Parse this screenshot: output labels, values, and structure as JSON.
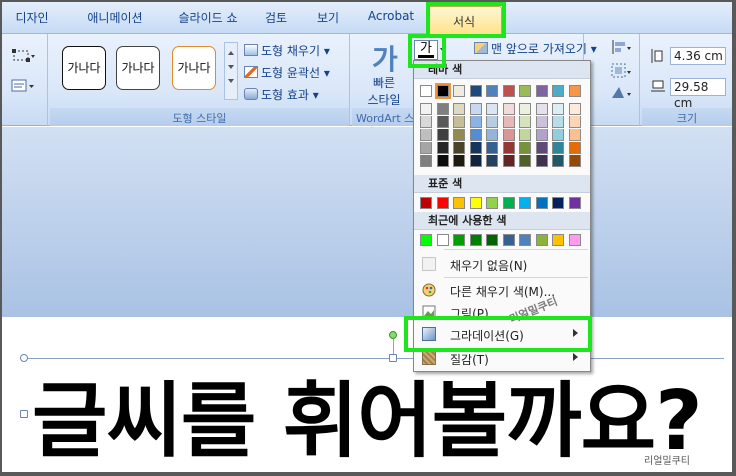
{
  "tabs": [
    "디자인",
    "애니메이션",
    "슬라이드 쇼",
    "검토",
    "보기",
    "Acrobat",
    "서식"
  ],
  "active_tab": "서식",
  "shape_style": {
    "preview_label": "가나다",
    "fill": "도형 채우기",
    "outline": "도형 윤곽선",
    "effects": "도형 효과",
    "group_label": "도형 스타일"
  },
  "wordart": {
    "quick_styles": "빠른\n스타일",
    "quick_line1": "빠른",
    "quick_line2": "스타일",
    "group_label": "WordArt 스",
    "font_color_glyph": "가"
  },
  "arrange": {
    "bring_front": "맨 앞으로 가져오기"
  },
  "size": {
    "height": "4.36 cm",
    "width": "29.58 cm",
    "group_label": "크기"
  },
  "dropdown": {
    "theme_colors_title": "테마 색",
    "standard_colors_title": "표준 색",
    "recent_colors_title": "최근에 사용한 색",
    "no_fill": "채우기 없음(N)",
    "more_fill_colors": "다른 채우기 색(M)...",
    "picture": "그림(P)...",
    "gradient": "그라데이션(G)",
    "texture": "질감(T)"
  },
  "theme_colors_top": [
    "#ffffff",
    "#000000",
    "#eeece1",
    "#1f497d",
    "#4f81bd",
    "#c0504d",
    "#9bbb59",
    "#8064a2",
    "#4bacc6",
    "#f79646"
  ],
  "theme_shades": [
    [
      "#f2f2f2",
      "#7f7f7f",
      "#ddd9c3",
      "#c6d9f0",
      "#dbe5f1",
      "#f2dcdb",
      "#ebf1dd",
      "#e5e0ec",
      "#dbeef3",
      "#fdeada"
    ],
    [
      "#d8d8d8",
      "#595959",
      "#c4bd97",
      "#8db3e2",
      "#b8cce4",
      "#e5b9b7",
      "#d7e3bc",
      "#ccc1d9",
      "#b7dde8",
      "#fbd5b5"
    ],
    [
      "#bfbfbf",
      "#3f3f3f",
      "#938953",
      "#548dd4",
      "#95b3d7",
      "#d99694",
      "#c3d69b",
      "#b2a2c7",
      "#92cddc",
      "#fac08f"
    ],
    [
      "#a5a5a5",
      "#262626",
      "#494429",
      "#17365d",
      "#366092",
      "#953734",
      "#76923c",
      "#5f497a",
      "#31859b",
      "#e36c09"
    ],
    [
      "#7f7f7f",
      "#0c0c0c",
      "#1d1b10",
      "#0f243e",
      "#244061",
      "#632423",
      "#4f6128",
      "#3f3151",
      "#205867",
      "#974806"
    ]
  ],
  "standard_colors": [
    "#c00000",
    "#ff0000",
    "#ffc000",
    "#ffff00",
    "#92d050",
    "#00b050",
    "#00b0f0",
    "#0070c0",
    "#002060",
    "#7030a0"
  ],
  "recent_colors": [
    "#00ff00",
    "#ffffff",
    "#00a000",
    "#008000",
    "#006400",
    "#376092",
    "#4f81bd",
    "#8db33a",
    "#ffc000",
    "#ff9cf0"
  ],
  "slide": {
    "headline": "글씨를 휘어볼까요?"
  },
  "watermark": "리얼밀쿠티",
  "highlight_color": "#1ee61e"
}
